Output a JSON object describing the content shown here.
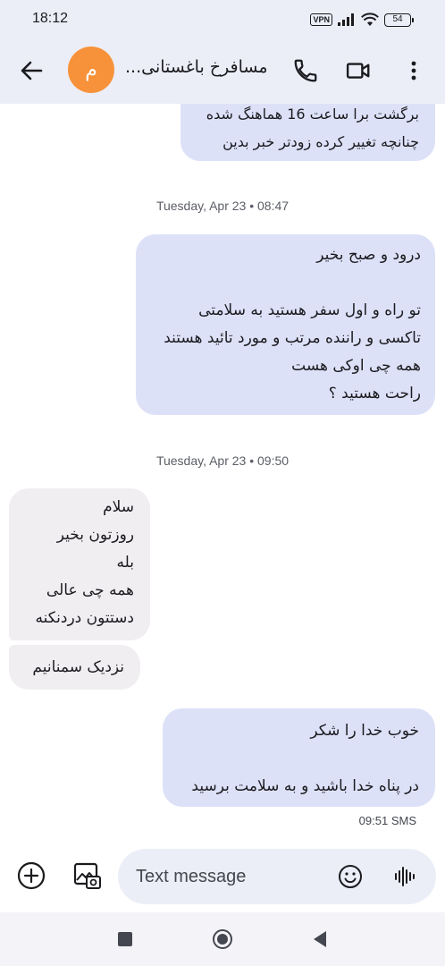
{
  "status_bar": {
    "time": "18:12",
    "vpn_label": "VPN",
    "battery_level": "54",
    "icons": [
      "vpn-icon",
      "signal-icon",
      "wifi-icon",
      "battery-icon"
    ]
  },
  "app_bar": {
    "avatar_letter": "م",
    "avatar_color": "#f7923a",
    "contact_name": "مسافرخ باغستانی...",
    "icons": [
      "back-arrow-icon",
      "phone-icon",
      "video-camera-icon",
      "more-vert-icon"
    ]
  },
  "messages": [
    {
      "direction": "outgoing",
      "text": "برگشت برا ساعت 16 هماهنگ شده\nچنانچه تغییر کرده زودتر خبر بدین"
    },
    {
      "type": "timestamp",
      "text": "Tuesday, Apr 23 • 08:47"
    },
    {
      "direction": "outgoing",
      "text": "درود و صبح بخیر\n\nتو راه و اول سفر هستید به سلامتی\nتاکسی و راننده مرتب و مورد تائید هستند\nهمه چی اوکی هست\nراحت هستید ؟"
    },
    {
      "type": "timestamp",
      "text": "Tuesday, Apr 23 • 09:50"
    },
    {
      "direction": "incoming",
      "text": "سلام\nروزتون بخیر\nبله\nهمه چی عالی\nدستتون دردنکنه"
    },
    {
      "direction": "incoming",
      "text": "نزدیک سمنانیم"
    },
    {
      "direction": "outgoing",
      "text": "خوب  خدا را شکر\n\nدر پناه خدا باشید و به سلامت برسید"
    },
    {
      "type": "meta",
      "text": "09:51 SMS"
    }
  ],
  "composer": {
    "placeholder": "Text message",
    "icons": [
      "add-circle-icon",
      "gallery-icon",
      "emoji-icon",
      "voice-waveform-icon"
    ]
  },
  "nav_bar": {
    "icons": [
      "recents-square-icon",
      "home-circle-icon",
      "back-triangle-icon"
    ]
  },
  "colors": {
    "surface": "#eceef7",
    "outgoing_bubble": "#dde1f8",
    "incoming_bubble": "#f1eef2",
    "timestamp_text": "#5b5e66"
  }
}
